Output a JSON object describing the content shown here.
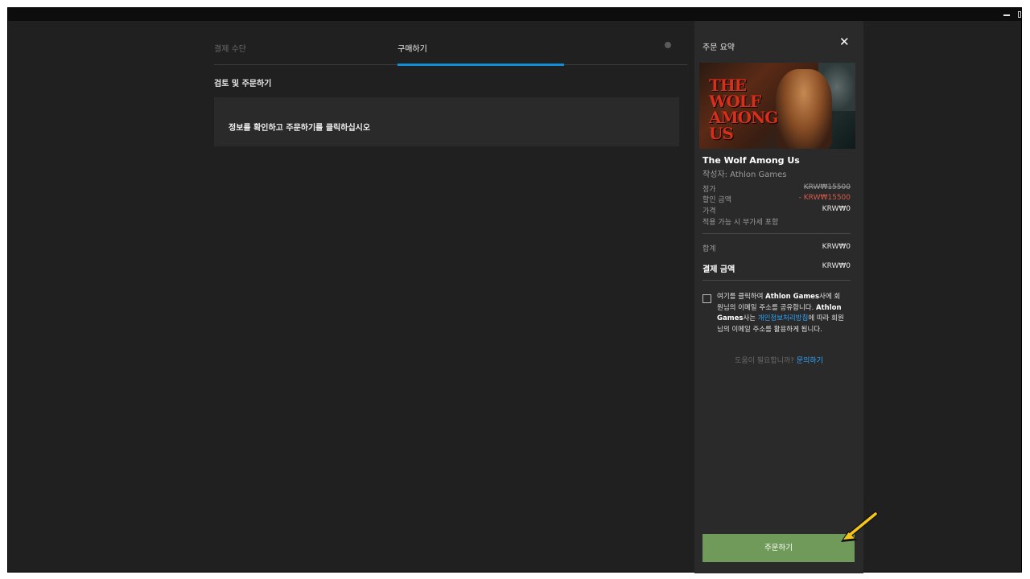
{
  "tabs": {
    "payment": "결제 수단",
    "purchase": "구매하기"
  },
  "review": {
    "title": "검토 및 주문하기",
    "message": "정보를 확인하고 주문하기를 클릭하십시오"
  },
  "summary": {
    "title": "주문 요약",
    "close": "✕",
    "cover_text": "THE WOLF AMONG US",
    "game_title": "The Wolf Among Us",
    "publisher": "작성자: Athlon Games",
    "list_price_label": "정가",
    "list_price": "KRW₩15500",
    "discount_label": "할인 금액",
    "discount": "- KRW₩15500",
    "price_label": "가격",
    "price": "KRW₩0",
    "vat_note": "적용 가능 시 부가세 포함",
    "subtotal_label": "합계",
    "subtotal": "KRW₩0",
    "total_label": "결제 금액",
    "total": "KRW₩0",
    "consent": {
      "part1": "여기를 클릭하여 ",
      "company1": "Athlon Games",
      "part2": "사에 회원님의 이메일 주소를 공유합니다. ",
      "company2": "Athlon Games",
      "part3": "사는 ",
      "privacy_link": "개인정보처리방침",
      "part4": "에 따라 회원님의 이메일 주소를 활용하게 됩니다."
    },
    "help_text": "도움이 필요합니까? ",
    "help_link": "문의하기",
    "order_button": "주문하기"
  },
  "colors": {
    "accent": "#0e8fd8",
    "order_button": "#6f9a59",
    "discount": "#d65a4a",
    "link": "#2fa6ff"
  },
  "icons": [
    "close-icon",
    "globe-icon",
    "checkbox",
    "annotation-arrow-icon"
  ]
}
